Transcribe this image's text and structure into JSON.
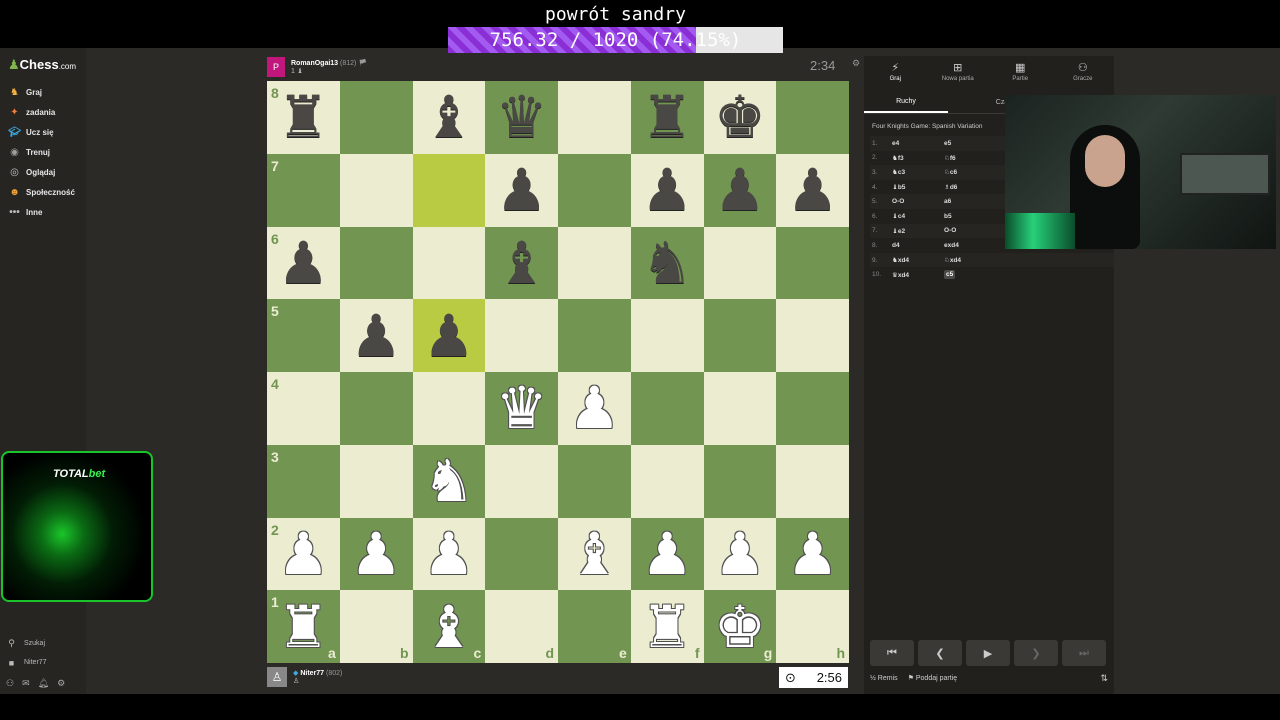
{
  "stream_overlay": {
    "title": "powrót sandry",
    "progress_text": "756.32 / 1020 (74.15%)",
    "progress_fraction": 0.7415
  },
  "sidebar": {
    "logo_text": "Chess",
    "logo_suffix": ".com",
    "items": [
      {
        "label": "Graj",
        "icon": "play-icon"
      },
      {
        "label": "zadania",
        "icon": "puzzle-icon"
      },
      {
        "label": "Ucz się",
        "icon": "learn-icon"
      },
      {
        "label": "Trenuj",
        "icon": "train-icon"
      },
      {
        "label": "Oglądaj",
        "icon": "watch-icon"
      },
      {
        "label": "Społeczność",
        "icon": "community-icon"
      },
      {
        "label": "Inne",
        "icon": "more-icon"
      }
    ],
    "search_label": "Szukaj",
    "user_label": "Niter77"
  },
  "ad": {
    "brand_total": "TOTAL",
    "brand_bet": "bet"
  },
  "top_player": {
    "avatar_letter": "P",
    "name": "RomanOgai13",
    "rating": "(812)",
    "captured": "1 ♝",
    "clock": "2:34"
  },
  "bottom_player": {
    "name": "Niter77",
    "rating": "(802)",
    "captured": "♙",
    "clock": "2:56"
  },
  "board": {
    "ranks": [
      "8",
      "7",
      "6",
      "5",
      "4",
      "3",
      "2",
      "1"
    ],
    "files": [
      "a",
      "b",
      "c",
      "d",
      "e",
      "f",
      "g",
      "h"
    ],
    "highlight_squares": [
      "c7",
      "c5"
    ],
    "position": [
      [
        "bR",
        "",
        "bB",
        "bQ",
        "",
        "bR",
        "bK",
        ""
      ],
      [
        "",
        "",
        "",
        "bP",
        "",
        "bP",
        "bP",
        "bP"
      ],
      [
        "bP",
        "",
        "",
        "bB",
        "",
        "bN",
        "",
        ""
      ],
      [
        "",
        "bP",
        "bP",
        "",
        "",
        "",
        "",
        ""
      ],
      [
        "",
        "",
        "",
        "wQ",
        "wP",
        "",
        "",
        ""
      ],
      [
        "",
        "",
        "wN",
        "",
        "",
        "",
        "",
        ""
      ],
      [
        "wP",
        "wP",
        "wP",
        "",
        "wB",
        "wP",
        "wP",
        "wP"
      ],
      [
        "wR",
        "",
        "wB",
        "",
        "",
        "wR",
        "wK",
        ""
      ]
    ]
  },
  "panel": {
    "tabs": [
      {
        "label": "Graj",
        "icon": "play-icon"
      },
      {
        "label": "Nowa partia",
        "icon": "plus-icon"
      },
      {
        "label": "Partie",
        "icon": "games-icon"
      },
      {
        "label": "Gracze",
        "icon": "players-icon"
      }
    ],
    "subtabs": [
      "Ruchy",
      "Czat"
    ],
    "opening": "Four Knights Game: Spanish Variation",
    "moves": [
      {
        "n": "1.",
        "w": "e4",
        "b": "e5"
      },
      {
        "n": "2.",
        "w": "♞f3",
        "b": "♘f6"
      },
      {
        "n": "3.",
        "w": "♞c3",
        "b": "♘c6"
      },
      {
        "n": "4.",
        "w": "♝b5",
        "b": "♗d6"
      },
      {
        "n": "5.",
        "w": "O-O",
        "b": "a6"
      },
      {
        "n": "6.",
        "w": "♝c4",
        "b": "b5"
      },
      {
        "n": "7.",
        "w": "♝e2",
        "b": "O-O"
      },
      {
        "n": "8.",
        "w": "d4",
        "b": "exd4"
      },
      {
        "n": "9.",
        "w": "♞xd4",
        "b": "♘xd4"
      },
      {
        "n": "10.",
        "w": "♛xd4",
        "b": "c5"
      }
    ],
    "draw_label": "Remis",
    "resign_label": "Poddaj partię"
  }
}
